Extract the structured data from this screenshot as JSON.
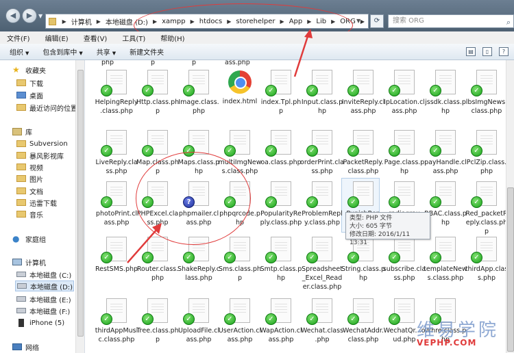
{
  "address": {
    "crumbs": [
      "计算机",
      "本地磁盘 (D:)",
      "xampp",
      "htdocs",
      "storehelper",
      "App",
      "Lib",
      "ORG"
    ],
    "search_placeholder": "搜索 ORG"
  },
  "menu": [
    "文件(F)",
    "编辑(E)",
    "查看(V)",
    "工具(T)",
    "帮助(H)"
  ],
  "commands": [
    {
      "label": "组织",
      "has_arrow": true
    },
    {
      "label": "包含到库中",
      "has_arrow": true
    },
    {
      "label": "共享",
      "has_arrow": true
    },
    {
      "label": "新建文件夹",
      "has_arrow": false
    }
  ],
  "nav": {
    "favorites": "收藏夹",
    "downloads": "下载",
    "desktop": "桌面",
    "recent": "最近访问的位置",
    "libraries": "库",
    "subversion": "Subversion",
    "storm": "暴风影视库",
    "videos": "视频",
    "pictures": "图片",
    "documents": "文档",
    "thunder": "迅雷下载",
    "music": "音乐",
    "homegroup": "家庭组",
    "computer": "计算机",
    "drive_c": "本地磁盘 (C:)",
    "drive_d": "本地磁盘 (D:)",
    "drive_e": "本地磁盘 (E:)",
    "drive_f": "本地磁盘 (F:)",
    "iphone": "iPhone (5)",
    "network": "网络"
  },
  "partial_top": [
    "php",
    "p",
    "p",
    "ass.php"
  ],
  "files": {
    "r1": [
      "HelpingReply.class.php",
      "Http.class.php",
      "Image.class.php",
      "index.html",
      "index.Tpl.php",
      "Input.class.php",
      "InviteReply.class.php",
      "IpLocation.class.php",
      "jssdk.class.php",
      "lbsImgNews.class.php"
    ],
    "r2": [
      "LiveReply.class.php",
      "Map.class.php",
      "Maps.class.php",
      "multiImgNews.class.php",
      "oa.class.php",
      "orderPrint.class.php",
      "PacketReply.class.php",
      "Page.class.php",
      "payHandle.class.php",
      "PclZip.class.php"
    ],
    "r3": [
      "photoPrint.class.php",
      "PHPExcel.class.php",
      "phpmailer.class.php",
      "phpqrcode.php",
      "PopularityReply.class.php",
      "ProblemReply.class.php",
      "PunishRep",
      "radiogrou",
      "RBAC.class.php",
      "Red_packetReply.class.php"
    ],
    "r4": [
      "RestSMS.php",
      "Router.class.php",
      "ShakeReply.class.php",
      "Sms.class.php",
      "Smtp.class.php",
      "Spreadsheet_Excel_Reader.class.php",
      "String.class.php",
      "subscribe.class.php",
      "templateNews.class.php",
      "thirdApp.class.php"
    ],
    "r5": [
      "thirdAppMusic.class.php",
      "Tree.class.php",
      "UploadFile.class.php",
      "UserAction.class.php",
      "WapAction.class.php",
      "Wechat.class.php",
      "WechatAddr.class.php",
      "WechatQr...oud.php",
      "Whre.class.php",
      ""
    ]
  },
  "tooltip": {
    "type": "类型: PHP 文件",
    "size": "大小: 605 字节",
    "modified": "修改日期: 2016/1/11 13:31"
  },
  "watermark": {
    "main": "维易学院",
    "sub": "VEPHP.COM"
  }
}
